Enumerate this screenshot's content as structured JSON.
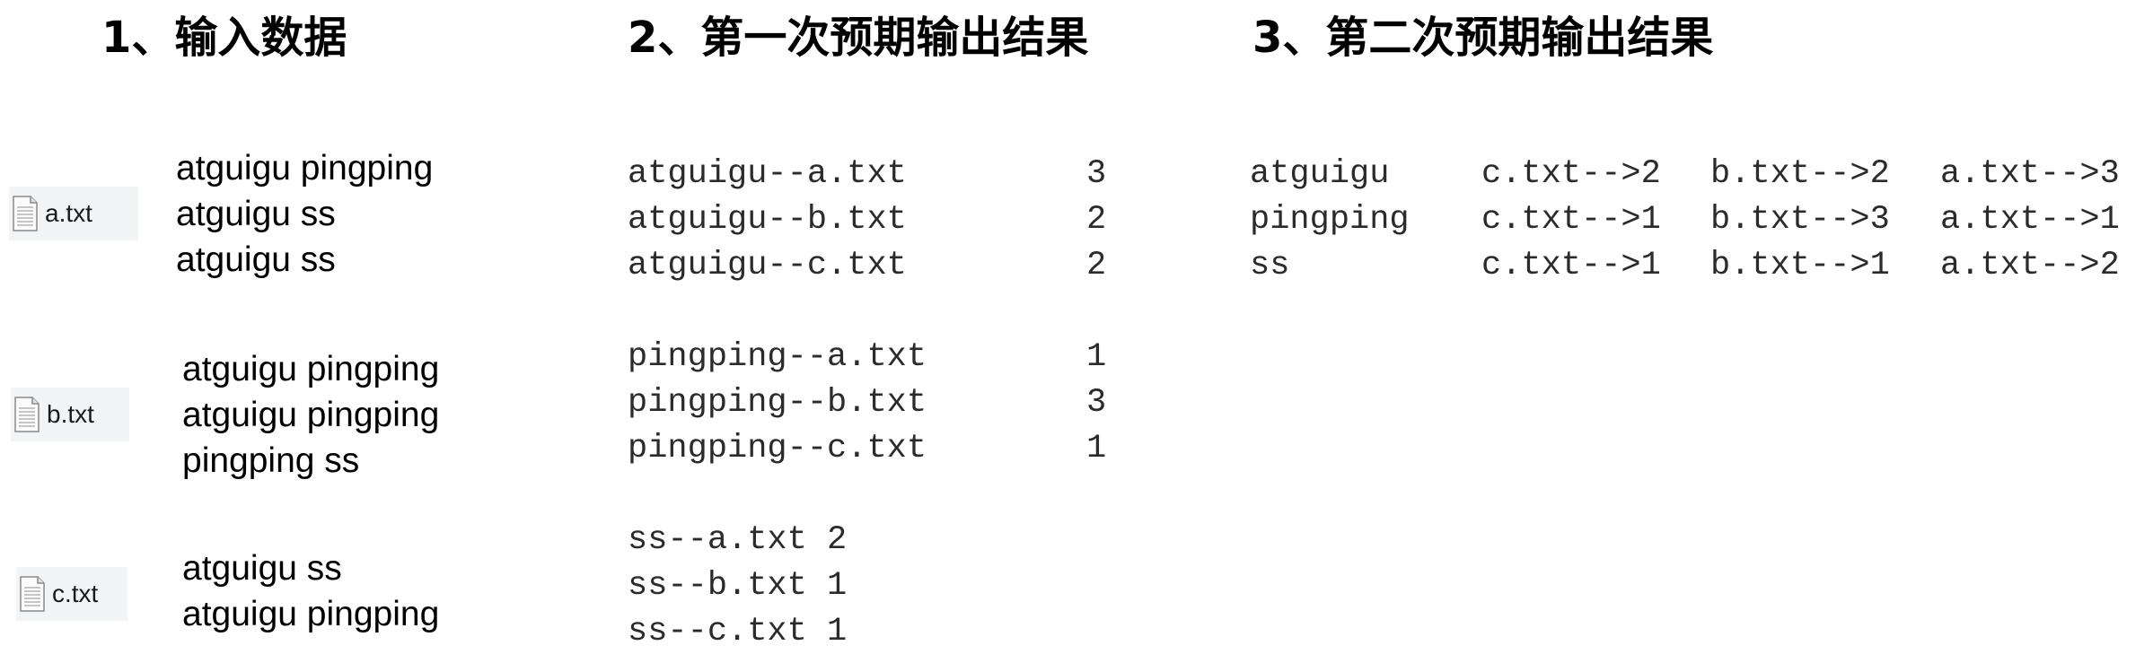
{
  "headings": {
    "input": "1、输入数据",
    "first": "2、第一次预期输出结果",
    "second": "3、第二次预期输出结果"
  },
  "files": [
    {
      "icon": "text-file-icon",
      "name": "a.txt",
      "lines": [
        "atguigu pingping",
        "atguigu ss",
        "atguigu ss"
      ]
    },
    {
      "icon": "text-file-icon",
      "name": "b.txt",
      "lines": [
        "atguigu pingping",
        "atguigu pingping",
        "pingping ss"
      ]
    },
    {
      "icon": "text-file-icon",
      "name": "c.txt",
      "lines": [
        "atguigu ss",
        "atguigu pingping"
      ]
    }
  ],
  "first_output": [
    {
      "keys": [
        "atguigu--a.txt",
        "atguigu--b.txt",
        "atguigu--c.txt"
      ],
      "counts": [
        "3",
        "2",
        "2"
      ]
    },
    {
      "keys": [
        "pingping--a.txt",
        "pingping--b.txt",
        "pingping--c.txt"
      ],
      "counts": [
        "1",
        "3",
        "1"
      ]
    },
    {
      "rows": [
        "ss--a.txt 2",
        "ss--b.txt 1",
        "ss--c.txt 1"
      ]
    }
  ],
  "second_output": {
    "words": [
      "atguigu",
      "pingping",
      "ss"
    ],
    "c": [
      "c.txt-->2",
      "c.txt-->1",
      "c.txt-->1"
    ],
    "b": [
      "b.txt-->2",
      "b.txt-->3",
      "b.txt-->1"
    ],
    "a": [
      "a.txt-->3",
      "a.txt-->1",
      "a.txt-->2"
    ]
  }
}
